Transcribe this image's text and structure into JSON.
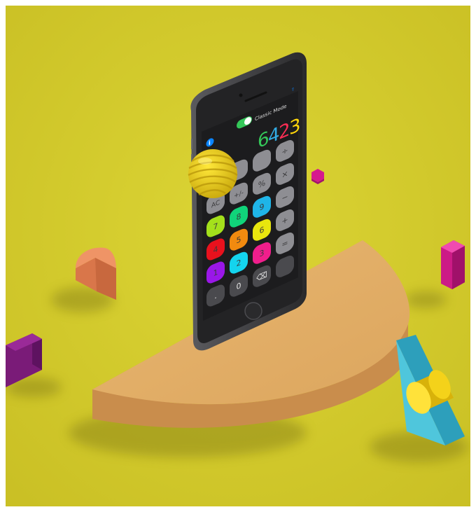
{
  "scene": {
    "description_colors": {
      "background": "#d4cc2c",
      "platform": "#e2ae66",
      "platform_side": "#d29c5a",
      "phone_body": "#3a3a3c",
      "screen": "#1c1c1e",
      "key_gray": "#8e8e93",
      "accent_yellow": "#f4d21a",
      "accent_magenta": "#d6198e",
      "accent_purple": "#7a1b78",
      "accent_cyan": "#3fbad0",
      "accent_orange": "#e8895a"
    }
  },
  "calculator": {
    "toggle_label": "Classic Mode",
    "display_digits": [
      {
        "char": "6",
        "color": "#34c759"
      },
      {
        "char": "4",
        "color": "#32ade6"
      },
      {
        "char": "2",
        "color": "#ff2d55"
      },
      {
        "char": "3",
        "color": "#ffd60a"
      }
    ],
    "keys": [
      {
        "label": "",
        "color": "#8e8e93"
      },
      {
        "label": "",
        "color": "#8e8e93"
      },
      {
        "label": "",
        "color": "#8e8e93"
      },
      {
        "label": "÷",
        "color": "#8e8e93"
      },
      {
        "label": "AC",
        "color": "#8e8e93"
      },
      {
        "label": "+/-",
        "color": "#8e8e93"
      },
      {
        "label": "%",
        "color": "#8e8e93"
      },
      {
        "label": "×",
        "color": "#8e8e93"
      },
      {
        "label": "7",
        "color": "#a4e01b"
      },
      {
        "label": "8",
        "color": "#10d47a"
      },
      {
        "label": "9",
        "color": "#1fb5e8"
      },
      {
        "label": "−",
        "color": "#8e8e93"
      },
      {
        "label": "4",
        "color": "#e8111d"
      },
      {
        "label": "5",
        "color": "#f28a0f"
      },
      {
        "label": "6",
        "color": "#e8e60e"
      },
      {
        "label": "+",
        "color": "#8e8e93"
      },
      {
        "label": "1",
        "color": "#9a17e8"
      },
      {
        "label": "2",
        "color": "#14d4ee"
      },
      {
        "label": "3",
        "color": "#f01e8c"
      },
      {
        "label": "=",
        "color": "#8e8e93"
      },
      {
        "label": ".",
        "color": "#4a4a4e"
      },
      {
        "label": "0",
        "color": "#4a4a4e"
      },
      {
        "label": "⌫",
        "color": "#4a4a4e"
      },
      {
        "label": "",
        "color": "#4a4a4e"
      }
    ]
  }
}
